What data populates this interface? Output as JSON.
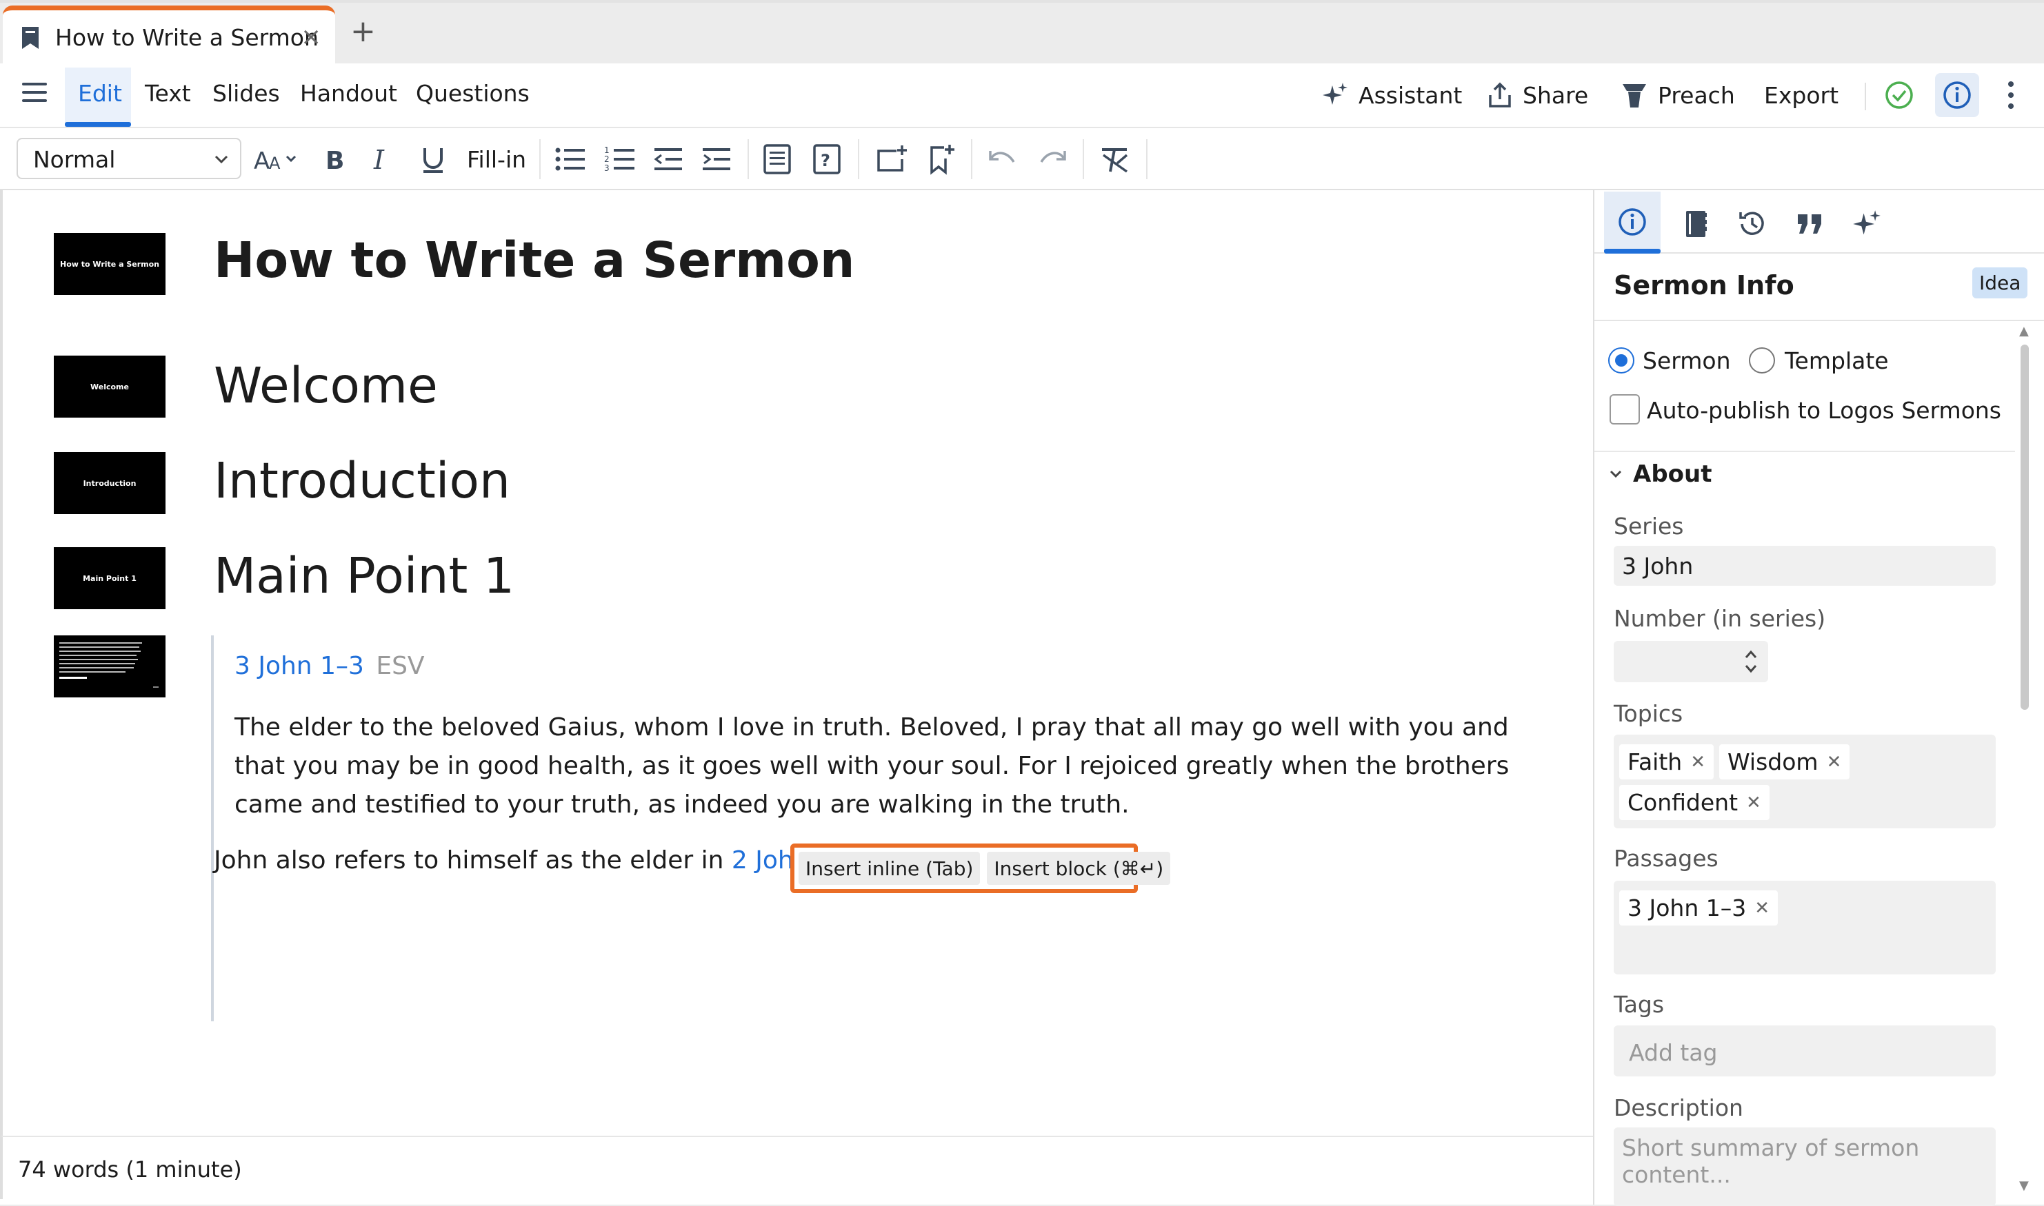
{
  "tab": {
    "title": "How to Write a Sermon",
    "close_glyph": "×",
    "new_tab_glyph": "+"
  },
  "menu": {
    "items": [
      "Edit",
      "Text",
      "Slides",
      "Handout",
      "Questions"
    ],
    "active": "Edit",
    "right_actions": [
      "Assistant",
      "Share",
      "Preach",
      "Export"
    ]
  },
  "toolbar": {
    "style_select": "Normal",
    "fill_in_label": "Fill-in",
    "buttons": [
      "font-size",
      "bold",
      "italic",
      "underline",
      "fill-in",
      "bullet-list",
      "numbered-list",
      "outdent",
      "indent",
      "block-insert",
      "question-insert",
      "slide-add",
      "bookmark-add",
      "undo",
      "redo",
      "clear-format"
    ]
  },
  "document": {
    "title": "How to Write a Sermon",
    "headings": [
      "Welcome",
      "Introduction",
      "Main Point 1"
    ],
    "thumbnails": [
      "How to Write a Sermon",
      "Welcome",
      "Introduction",
      "Main Point 1"
    ],
    "passage": {
      "reference": "3 John 1–3",
      "version": "ESV",
      "text": "The elder to the beloved Gaius, whom I love in truth. Beloved, I pray that all may go well with you and that you may be in good health, as it goes well with your soul. For I rejoiced greatly when the brothers came and testified to your truth, as indeed you are walking in the truth."
    },
    "paragraph_prefix": "John also refers to himself as the elder in ",
    "paragraph_link": "2 John 1",
    "insert_popup": {
      "inline": "Insert inline (Tab)",
      "block": "Insert block (⌘↵)"
    }
  },
  "status": {
    "word_count": "74 words (1 minute)"
  },
  "panel": {
    "title": "Sermon Info",
    "badge": "Idea",
    "type_options": [
      "Sermon",
      "Template"
    ],
    "type_selected": "Sermon",
    "autopublish_label": "Auto-publish to Logos Sermons",
    "autopublish_checked": false,
    "about_label": "About",
    "fields": {
      "series_label": "Series",
      "series_value": "3 John",
      "number_label": "Number (in series)",
      "number_value": "",
      "topics_label": "Topics",
      "topics": [
        "Faith",
        "Wisdom",
        "Confident"
      ],
      "passages_label": "Passages",
      "passages": [
        "3 John 1–3"
      ],
      "tags_label": "Tags",
      "tags_placeholder": "Add tag",
      "description_label": "Description",
      "description_placeholder": "Short summary of sermon content..."
    }
  },
  "colors": {
    "accent": "#1f6fd9",
    "tab_accent": "#ea6d26",
    "success": "#4caf50"
  }
}
